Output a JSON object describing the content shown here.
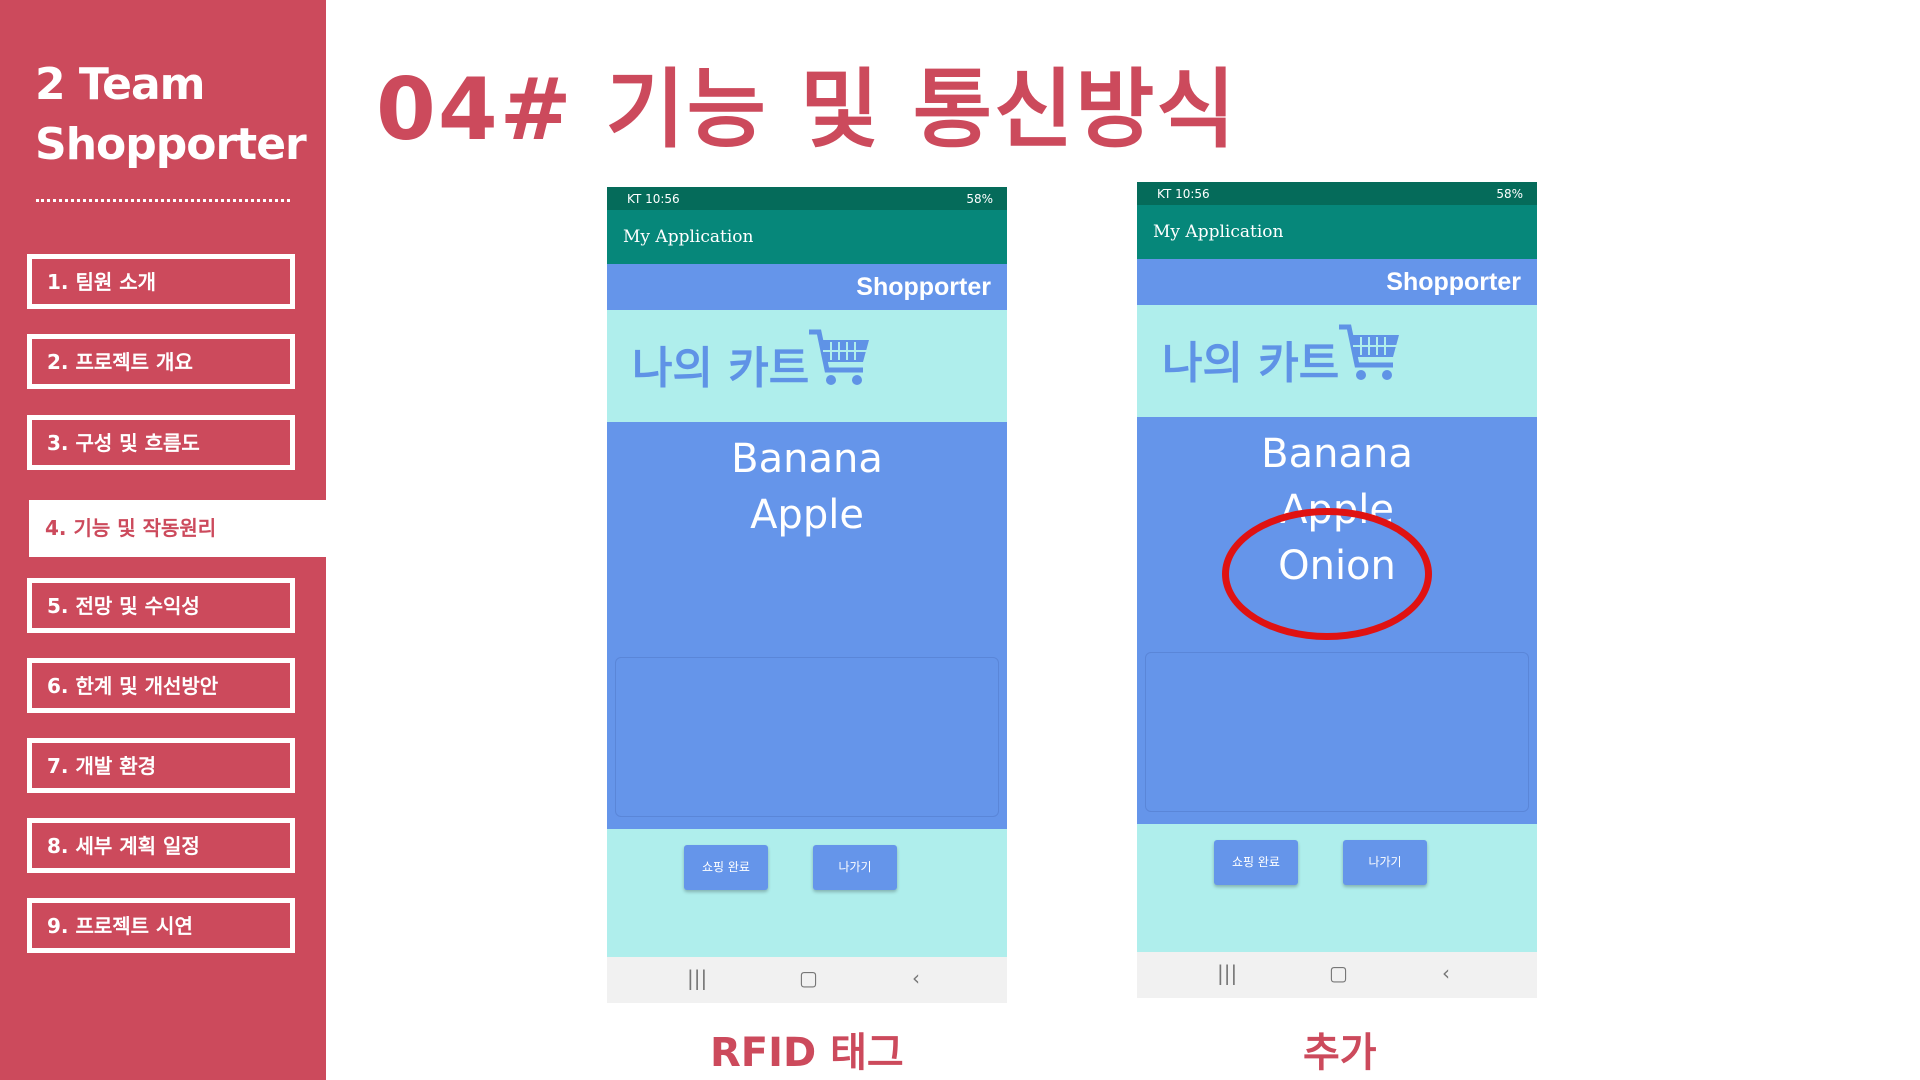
{
  "sidebar": {
    "team_line1": "2 Team",
    "team_line2": "Shopporter",
    "items": [
      {
        "label": "1. 팀원 소개"
      },
      {
        "label": "2. 프로젝트 개요"
      },
      {
        "label": "3. 구성 및 흐름도"
      },
      {
        "label": "4. 기능 및 작동원리"
      },
      {
        "label": "5. 전망 및 수익성"
      },
      {
        "label": "6. 한계 및 개선방안"
      },
      {
        "label": "7. 개발 환경"
      },
      {
        "label": "8. 세부 계획 일정"
      },
      {
        "label": "9. 프로젝트 시연"
      }
    ],
    "active_index": 3
  },
  "main": {
    "title": "04# 기능 및 통신방식"
  },
  "phones": [
    {
      "status_left": "KT 10:56",
      "status_right": "58%",
      "app_title": "My Application",
      "brand": "Shopporter",
      "cart_title": "나의 카트",
      "items": [
        "Banana",
        "Apple"
      ],
      "buttons": [
        "쇼핑 완료",
        "나가기"
      ],
      "caption": "RFID 태그"
    },
    {
      "status_left": "KT 10:56",
      "status_right": "58%",
      "app_title": "My Application",
      "brand": "Shopporter",
      "cart_title": "나의 카트",
      "items": [
        "Banana",
        "Apple",
        "Onion"
      ],
      "buttons": [
        "쇼핑 완료",
        "나가기"
      ],
      "caption": "추가"
    }
  ],
  "colors": {
    "accent": "#cc4a5c",
    "appbar": "#06877a",
    "statusbar": "#056b5a",
    "list_bg": "#6595ea",
    "light_bg": "#afeeec",
    "highlight_circle": "#e01212"
  }
}
